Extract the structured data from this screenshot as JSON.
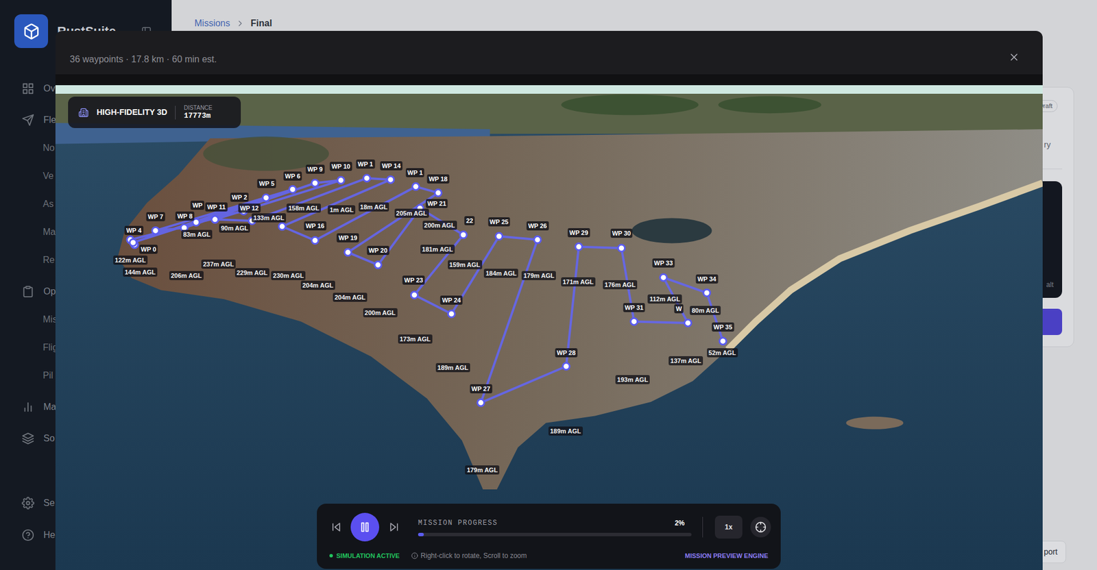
{
  "sidebar": {
    "brand": "RustSuite",
    "items": [
      {
        "label": "Ov",
        "kind": "section"
      },
      {
        "label": "Fle",
        "kind": "section"
      },
      {
        "label": "No",
        "kind": "subitem"
      },
      {
        "label": "Ve",
        "kind": "subitem"
      },
      {
        "label": "As",
        "kind": "subitem"
      },
      {
        "label": "Ma",
        "kind": "subitem"
      },
      {
        "label": "Re",
        "kind": "subitem"
      },
      {
        "label": "Op",
        "kind": "section"
      },
      {
        "label": "Mis",
        "kind": "subitem"
      },
      {
        "label": "Flig",
        "kind": "subitem"
      },
      {
        "label": "Pil",
        "kind": "subitem"
      },
      {
        "label": "Ma",
        "kind": "section"
      },
      {
        "label": "So",
        "kind": "section"
      }
    ],
    "footer_items": [
      {
        "label": "Se"
      },
      {
        "label": "He"
      }
    ]
  },
  "breadcrumb": {
    "items": [
      "Missions",
      "Final"
    ]
  },
  "detail_panel": {
    "status_badge": "Draft",
    "label": "ry",
    "preview_note": "alt",
    "footer_button": "port"
  },
  "modal": {
    "subtitle": "36 waypoints · 17.8 km · 60 min est.",
    "view_badge": {
      "title": "HIGH-FIDELITY 3D",
      "stat_label": "DISTANCE",
      "stat_value": "17773m"
    },
    "waypoints": [
      {
        "label": "WP 0"
      },
      {
        "label": ""
      },
      {
        "label": "WP 2"
      },
      {
        "label": "WP"
      },
      {
        "label": "WP 4"
      },
      {
        "label": "WP 5"
      },
      {
        "label": "WP 6"
      },
      {
        "label": "WP 7"
      },
      {
        "label": "WP 8"
      },
      {
        "label": "WP 9"
      },
      {
        "label": "WP 10"
      },
      {
        "label": "WP 11"
      },
      {
        "label": "WP 12"
      },
      {
        "label": "WP 1"
      },
      {
        "label": "WP 14"
      },
      {
        "label": ""
      },
      {
        "label": "WP 16"
      },
      {
        "label": "WP 1"
      },
      {
        "label": "WP 18"
      },
      {
        "label": "WP 19"
      },
      {
        "label": "WP 20"
      },
      {
        "label": "WP 21"
      },
      {
        "label": "22"
      },
      {
        "label": "WP 23"
      },
      {
        "label": "WP 24"
      },
      {
        "label": "WP 25"
      },
      {
        "label": "WP 26"
      },
      {
        "label": "WP 27"
      },
      {
        "label": "WP 28"
      },
      {
        "label": "WP 29"
      },
      {
        "label": "WP 30"
      },
      {
        "label": "WP 31"
      },
      {
        "label": "W"
      },
      {
        "label": "WP 33"
      },
      {
        "label": "WP 34"
      },
      {
        "label": "WP 35"
      }
    ],
    "altitude_labels": [
      "122m AGL",
      "144m AGL",
      "83m AGL",
      "90m AGL",
      "133m AGL",
      "158m AGL",
      "1m AGL",
      "18m AGL",
      "205m AGL",
      "200m AGL",
      "206m AGL",
      "237m AGL",
      "229m AGL",
      "230m AGL",
      "204m AGL",
      "204m AGL",
      "200m AGL",
      "173m AGL",
      "189m AGL",
      "179m AGL",
      "189m AGL",
      "193m AGL",
      "137m AGL",
      "52m AGL",
      "80m AGL",
      "112m AGL",
      "176m AGL",
      "171m AGL",
      "179m AGL",
      "184m AGL",
      "159m AGL",
      "181m AGL"
    ],
    "player": {
      "playing": true,
      "progress_label": "MISSION PROGRESS",
      "progress_value": "2%",
      "level": 0.02,
      "speed": "1x",
      "status": "SIMULATION ACTIVE",
      "active": true,
      "hint": "Right-click to rotate, Scroll to zoom",
      "engine": "MISSION PREVIEW ENGINE"
    }
  }
}
